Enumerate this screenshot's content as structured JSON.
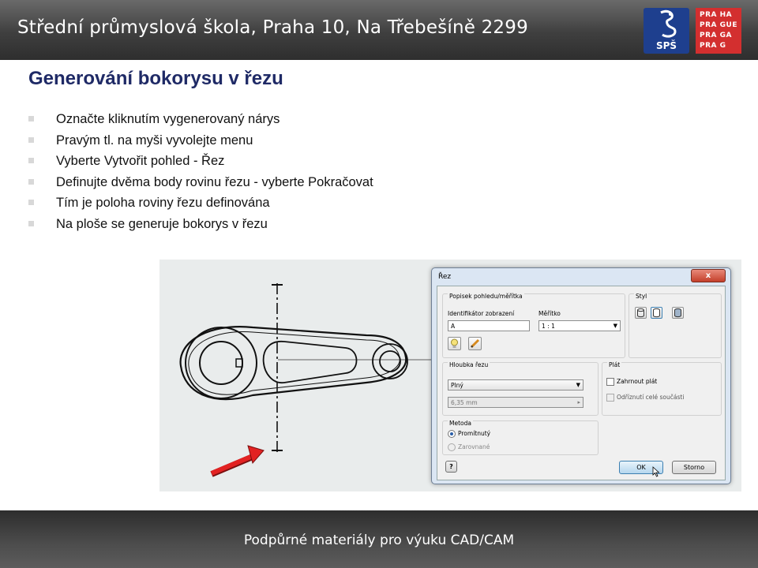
{
  "header": {
    "title": "Střední průmyslová škola, Praha 10, Na Třebešíně 2299",
    "logo_sps": "SPŠ",
    "logo_prague_lines": [
      "PRA HA",
      "PRA GUE",
      "PRA GA",
      "PRA G"
    ]
  },
  "slide": {
    "title": "Generování bokorysu v řezu",
    "bullets": [
      "Označte kliknutím vygenerovaný nárys",
      "Pravým tl. na myši vyvolejte menu",
      "Vyberte Vytvořit pohled - Řez",
      "Definujte dvěma body rovinu řezu - vyberte Pokračovat",
      "Tím je poloha roviny řezu definována",
      "Na ploše se generuje bokorys v řezu"
    ]
  },
  "dialog": {
    "title": "Řez",
    "close_symbol": "x",
    "group_view_label": "Popisek pohledu/měřítka",
    "identifier_label": "Identifikátor zobrazení",
    "identifier_value": "A",
    "scale_label": "Měřítko",
    "scale_value": "1 : 1",
    "style_label": "Styl",
    "depth_group_label": "Hloubka řezu",
    "depth_value": "Plný",
    "depth_distance": "6,35 mm",
    "sheet_group_label": "Plát",
    "sheet_option_1": "Zahrnout plát",
    "sheet_option_2": "Odříznutí celé součásti",
    "method_group_label": "Metoda",
    "method_option_1": "Promítnutý",
    "method_option_2": "Zarovnané",
    "help_icon": "?",
    "ok_label": "OK",
    "cancel_label": "Storno"
  },
  "footer": {
    "text": "Podpůrné materiály pro výuku CAD/CAM"
  },
  "colors": {
    "title": "#1f2a66",
    "arrow": "#e22222",
    "dialog_frame": "#dbe6f3"
  }
}
